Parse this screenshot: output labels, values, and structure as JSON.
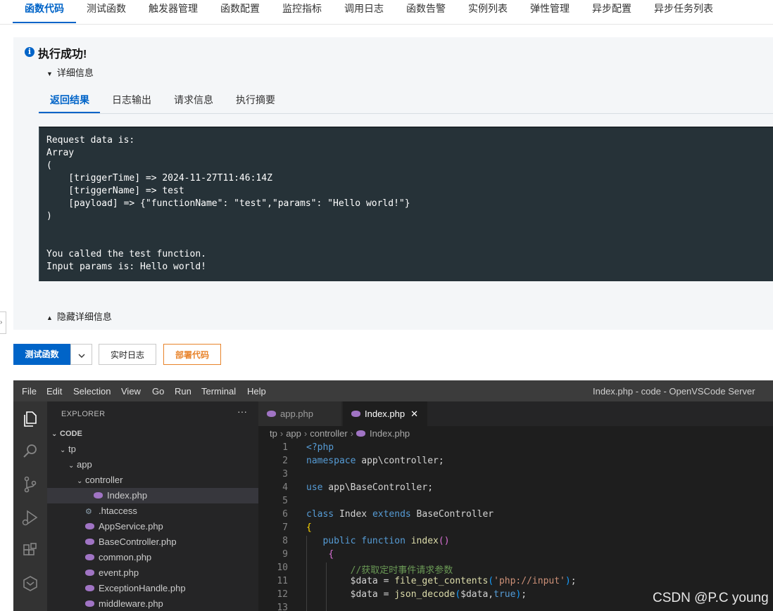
{
  "top_tabs": [
    "函数代码",
    "测试函数",
    "触发器管理",
    "函数配置",
    "监控指标",
    "调用日志",
    "函数告警",
    "实例列表",
    "弹性管理",
    "异步配置",
    "异步任务列表"
  ],
  "result": {
    "title": "执行成功!",
    "details_toggle": "详细信息",
    "hide_toggle": "隐藏详细信息",
    "sub_tabs": [
      "返回结果",
      "日志输出",
      "请求信息",
      "执行摘要"
    ],
    "output_lines": [
      "Request data is:",
      "Array",
      "(",
      "    [triggerTime] => 2024-11-27T11:46:14Z",
      "    [triggerName] => test",
      "    [payload] => {\"functionName\": \"test\",\"params\": \"Hello world!\"}",
      ")",
      "",
      "",
      "You called the test function.",
      "Input params is: Hello world!"
    ]
  },
  "buttons": {
    "test_function": "测试函数",
    "realtime_log": "实时日志",
    "deploy_code": "部署代码"
  },
  "vscode": {
    "menu": [
      "File",
      "Edit",
      "Selection",
      "View",
      "Go",
      "Run",
      "Terminal",
      "Help"
    ],
    "window_title": "Index.php - code - OpenVSCode Server",
    "activity_icons": [
      "explorer-icon",
      "search-icon",
      "source-control-icon",
      "run-debug-icon",
      "extensions-icon",
      "remote-icon"
    ],
    "explorer": {
      "title": "EXPLORER",
      "more": "···",
      "tree": [
        {
          "label": "CODE",
          "depth": 0,
          "chevron": "down",
          "icon": "none",
          "bold": true
        },
        {
          "label": "tp",
          "depth": 1,
          "chevron": "down",
          "icon": "none"
        },
        {
          "label": "app",
          "depth": 2,
          "chevron": "down",
          "icon": "none"
        },
        {
          "label": "controller",
          "depth": 3,
          "chevron": "down",
          "icon": "none"
        },
        {
          "label": "Index.php",
          "depth": 4,
          "chevron": "none",
          "icon": "php",
          "selected": true
        },
        {
          "label": ".htaccess",
          "depth": 3,
          "chevron": "none",
          "icon": "gear"
        },
        {
          "label": "AppService.php",
          "depth": 3,
          "chevron": "none",
          "icon": "php"
        },
        {
          "label": "BaseController.php",
          "depth": 3,
          "chevron": "none",
          "icon": "php"
        },
        {
          "label": "common.php",
          "depth": 3,
          "chevron": "none",
          "icon": "php"
        },
        {
          "label": "event.php",
          "depth": 3,
          "chevron": "none",
          "icon": "php"
        },
        {
          "label": "ExceptionHandle.php",
          "depth": 3,
          "chevron": "none",
          "icon": "php"
        },
        {
          "label": "middleware.php",
          "depth": 3,
          "chevron": "none",
          "icon": "php"
        }
      ]
    },
    "tabs": [
      {
        "label": "app.php",
        "active": false
      },
      {
        "label": "Index.php",
        "active": true,
        "close": "✕"
      }
    ],
    "breadcrumb": [
      "tp",
      "app",
      "controller",
      "Index.php"
    ],
    "code_lines": [
      {
        "n": "1",
        "html": "<span class=\"tag\">&lt;?php</span>"
      },
      {
        "n": "2",
        "html": "<span class=\"kw\">namespace</span> app\\controller;"
      },
      {
        "n": "3",
        "html": ""
      },
      {
        "n": "4",
        "html": "<span class=\"kw\">use</span> app\\BaseController;"
      },
      {
        "n": "5",
        "html": ""
      },
      {
        "n": "6",
        "html": "<span class=\"kw\">class</span> Index <span class=\"kw\">extends</span> BaseController"
      },
      {
        "n": "7",
        "html": "<span class=\"br1\">{</span>"
      },
      {
        "n": "8",
        "html": "   <span class=\"kw\">public</span> <span class=\"kw\">function</span> <span class=\"fn\">index</span><span class=\"br2\">()</span>"
      },
      {
        "n": "9",
        "html": "    <span class=\"br2\">{</span>"
      },
      {
        "n": "10",
        "html": "        <span class=\"cmt\">//获取定时事件请求参数</span>"
      },
      {
        "n": "11",
        "html": "        $data = <span class=\"fn\">file_get_contents</span><span class=\"br3\">(</span><span class=\"str\">'php://input'</span><span class=\"br3\">)</span>;"
      },
      {
        "n": "12",
        "html": "        $data = <span class=\"fn\">json_decode</span><span class=\"br3\">(</span>$data,<span class=\"kw\">true</span><span class=\"br3\">)</span>;"
      },
      {
        "n": "13",
        "html": ""
      }
    ]
  },
  "watermark": "CSDN @P.C young",
  "colors": {
    "primary": "#0064c8",
    "deploy": "#e8832a",
    "console_bg": "#263238",
    "editor_bg": "#1e1e1e"
  }
}
